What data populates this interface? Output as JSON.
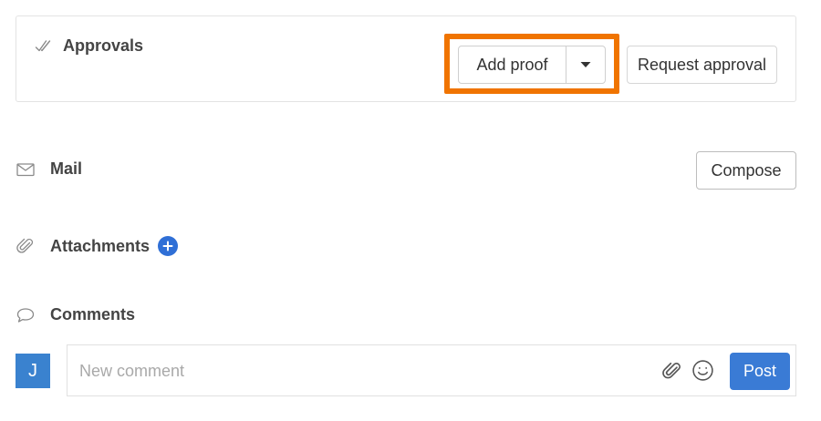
{
  "approvals": {
    "title": "Approvals",
    "icon": "double-check-icon",
    "add_proof_label": "Add proof",
    "request_approval_label": "Request approval",
    "highlight_color": "#f07400"
  },
  "mail": {
    "title": "Mail",
    "icon": "envelope-icon",
    "compose_label": "Compose"
  },
  "attachments": {
    "title": "Attachments",
    "icon": "paperclip-icon",
    "add_icon": "plus-circle-icon"
  },
  "comments": {
    "title": "Comments",
    "icon": "speech-bubble-icon",
    "avatar_initial": "J",
    "placeholder": "New comment",
    "post_label": "Post",
    "accent_color": "#3a7bd5"
  }
}
